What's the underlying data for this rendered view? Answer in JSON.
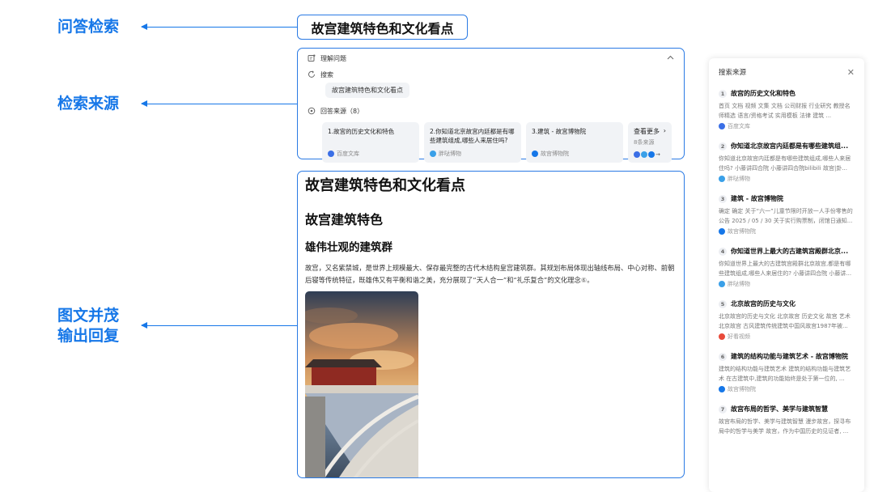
{
  "annotations": {
    "qa_search": "问答检索",
    "search_sources": "检索来源",
    "rich_output_line1": "图文并茂",
    "rich_output_line2": "输出回复"
  },
  "query": "故宫建筑特色和文化看点",
  "search_panel": {
    "understand_label": "理解问题",
    "search_label": "搜索",
    "search_chip": "故宫建筑特色和文化看点",
    "refs_label": "回答来源（8）",
    "cards": [
      {
        "title": "1.故宫的历史文化和特色",
        "source": "百度文库",
        "icon_color": "#3b6fe6"
      },
      {
        "title": "2.你知道北京故宫内廷都是有哪些建筑组成,哪些人来居住吗?",
        "source": "胖哒博物",
        "icon_color": "#3aa0e8"
      },
      {
        "title": "3.建筑 - 故宫博物院",
        "source": "故宫博物院",
        "icon_color": "#1677e8"
      }
    ],
    "more": {
      "title": "查看更多",
      "count": "8条来源"
    }
  },
  "answer": {
    "title": "故宫建筑特色和文化看点",
    "section_title": "故宫建筑特色",
    "subsection_title": "雄伟壮观的建筑群",
    "paragraph": "故宫，又名紫禁城，是世界上规模最大、保存最完整的古代木结构皇宫建筑群。其规划布局体现出轴线布局、中心对称、前朝后寝等传统特征，既雄伟又有平衡和谐之美，充分展现了“天人合一”和“礼乐复合”的文化理念",
    "citation": "⑥",
    "period": "。"
  },
  "sources": {
    "header": "搜索来源",
    "items": [
      {
        "num": "1",
        "title": "故宫的历史文化和特色",
        "snippet": "首页 文档 视频 文集 文档 公司财报 行业研究 教授名师精选 语言/资格考试 实用模板 法律 建筑 ...",
        "site": "百度文库",
        "site_color": "#3b6fe6"
      },
      {
        "num": "2",
        "title": "你知道北京故宫内廷都是有哪些建筑组...",
        "snippet": "你知道北京故宫内廷都是有哪些建筑组成,哪些人来居住吗? 小藤讲四合院 小藤讲四合院bilibili 故宫|卦...",
        "site": "胖哒博物",
        "site_color": "#3aa0e8"
      },
      {
        "num": "3",
        "title": "建筑 - 故宫博物院",
        "snippet": "确定 确定 关于“六一”儿童节限时开放一人手份零售的公告 2025 / 05 / 30 关于实行购票制，闭馆日通知...",
        "site": "故宫博物院",
        "site_color": "#1677e8"
      },
      {
        "num": "4",
        "title": "你知道世界上最大的古建筑宫殿群北京...",
        "snippet": "你知道世界上最大的古建筑宫殿群北京故宫,都是有哪些建筑组成,哪些人来居住的? 小藤讲四合院 小藤讲...",
        "site": "胖哒博物",
        "site_color": "#3aa0e8"
      },
      {
        "num": "5",
        "title": "北京故宫的历史与文化",
        "snippet": "北京故宫的历史与文化 北京故宫 历史文化 故宫 艺术 北京故宫 古风建筑传统建筑中国风故宫1987年被...",
        "site": "好看视频",
        "site_color": "#e84a3a"
      },
      {
        "num": "6",
        "title": "建筑的结构功能与建筑艺术 - 故宫博物院",
        "snippet": "建筑的结构功能与建筑艺术 建筑的结构功能与建筑艺术 在古建筑中,建筑的功能始终是处于第一位的, ...",
        "site": "故宫博物院",
        "site_color": "#1677e8"
      },
      {
        "num": "7",
        "title": "故宫布局的哲学、美学与建筑智慧",
        "snippet": "故宫布局的哲学、美学与建筑智慧 漫步故宫，探寻布局中的哲学与美学 故宫，作为中国历史的见证者, ...",
        "site": "",
        "site_color": "#999999"
      }
    ]
  }
}
